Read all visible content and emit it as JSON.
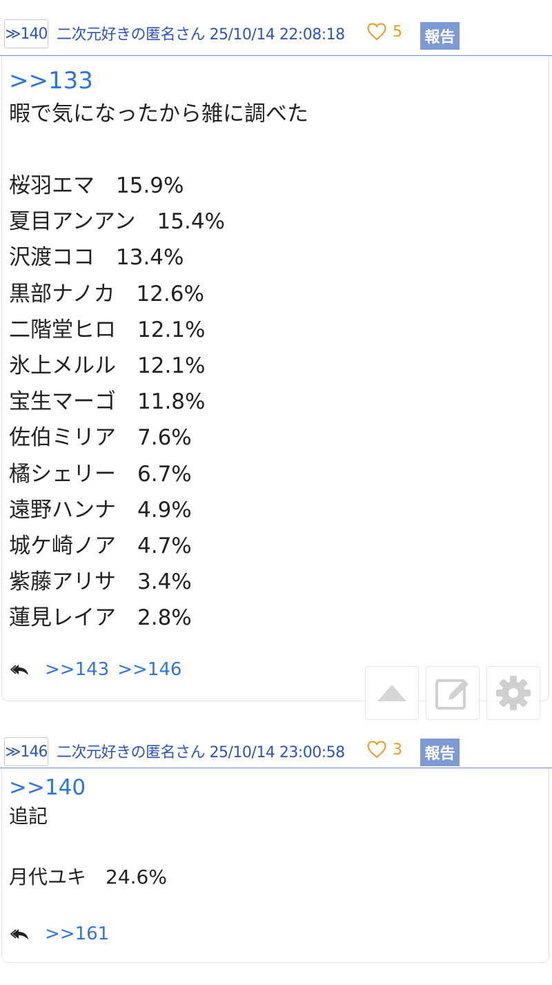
{
  "posts": [
    {
      "res_number": "140",
      "author": "二次元好きの匿名さん",
      "timestamp": "25/10/14 22:08:18",
      "likes": "5",
      "report_label": "報告",
      "anchor": ">>133",
      "intro": "暇で気になったから雑に調べた",
      "ranking": [
        {
          "name": "桜羽エマ",
          "sep": "　",
          "value": "15.9%"
        },
        {
          "name": "夏目アンアン",
          "sep": "　",
          "value": "15.4%"
        },
        {
          "name": "沢渡ココ",
          "sep": "　",
          "value": "13.4%"
        },
        {
          "name": "黒部ナノカ",
          "sep": "　",
          "value": "12.6%"
        },
        {
          "name": "二階堂ヒロ",
          "sep": "　",
          "value": "12.1%"
        },
        {
          "name": "氷上メルル",
          "sep": "　",
          "value": "12.1%"
        },
        {
          "name": "宝生マーゴ",
          "sep": "　",
          "value": "11.8%"
        },
        {
          "name": "佐伯ミリア",
          "sep": "　",
          "value": "7.6%"
        },
        {
          "name": "橘シェリー",
          "sep": "　",
          "value": "6.7%"
        },
        {
          "name": "遠野ハンナ",
          "sep": "　",
          "value": "4.9%"
        },
        {
          "name": "城ケ崎ノア",
          "sep": "　",
          "value": "4.7%"
        },
        {
          "name": "紫藤アリサ",
          "sep": "　",
          "value": "3.4%"
        },
        {
          "name": "蓮見レイア",
          "sep": "　",
          "value": "2.8%"
        }
      ],
      "replies": [
        ">>143",
        ">>146"
      ]
    },
    {
      "res_number": "146",
      "author": "二次元好きの匿名さん",
      "timestamp": "25/10/14 23:00:58",
      "likes": "3",
      "report_label": "報告",
      "anchor": ">>140",
      "intro": "追記",
      "ranking": [
        {
          "name": "月代ユキ",
          "sep": "　",
          "value": "24.6%"
        }
      ],
      "replies": [
        ">>161"
      ]
    }
  ],
  "floating_buttons": {
    "scroll_top_icon": "triangle-up-icon",
    "compose_icon": "edit-icon",
    "settings_icon": "gear-icon"
  },
  "colors": {
    "link": "#2d76e0",
    "header_text": "#2d56b8",
    "like": "#f09a1c",
    "report_bg": "#7d9ad2"
  }
}
